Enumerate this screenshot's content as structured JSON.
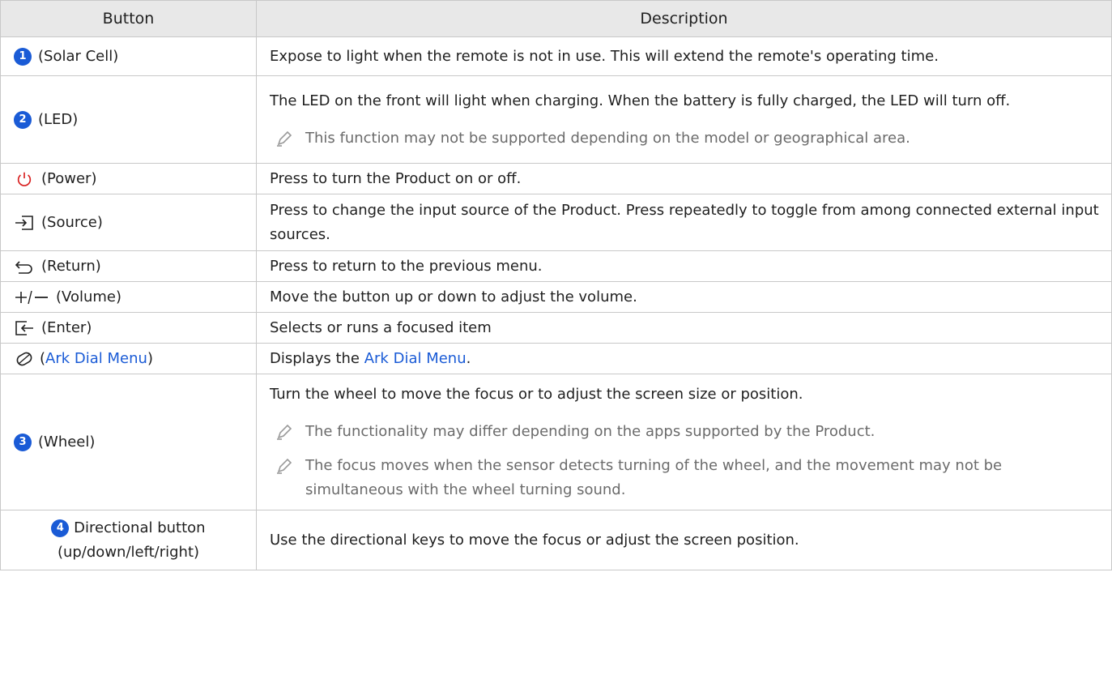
{
  "header": {
    "col1": "Button",
    "col2": "Description"
  },
  "rows": [
    {
      "badge": "1",
      "label": "(Solar Cell)",
      "desc": "Expose to light when the remote is not in use. This will extend the remote's operating time."
    },
    {
      "badge": "2",
      "label": "(LED)",
      "desc": "The LED on the front will light when charging. When the battery is fully charged, the LED will turn off.",
      "note": "This function may not be supported depending on the model or geographical area."
    },
    {
      "icon": "power-icon",
      "label": "(Power)",
      "desc": "Press to turn the Product on or off."
    },
    {
      "icon": "source-icon",
      "label": "(Source)",
      "desc": "Press to change the input source of the Product. Press repeatedly to toggle from among connected external input sources."
    },
    {
      "icon": "return-icon",
      "label": "(Return)",
      "desc": "Press to return to the previous menu."
    },
    {
      "icon": "volume-icon",
      "label": "(Volume)",
      "desc": "Move the button up or down to adjust the volume."
    },
    {
      "icon": "enter-icon",
      "label": "(Enter)",
      "desc": "Selects or runs a focused item"
    },
    {
      "icon": "ark-dial-icon",
      "label_open": "(",
      "link": "Ark Dial Menu",
      "label_close": ")",
      "desc_pre": "Displays the ",
      "desc_link": "Ark Dial Menu",
      "desc_post": "."
    },
    {
      "badge": "3",
      "label": "(Wheel)",
      "desc": "Turn the wheel to move the focus or to adjust the screen size or position.",
      "notes": [
        "The functionality may differ depending on the apps supported by the Product.",
        "The focus moves when the sensor detects turning of the wheel, and the movement may not be simultaneous with the wheel turning sound."
      ]
    },
    {
      "badge": "4",
      "label": "Directional button (up/down/left/right)",
      "desc": "Use the directional keys to move the focus or adjust the screen position."
    }
  ],
  "colors": {
    "badge": "#1a5bd6",
    "power": "#d81e1e",
    "link": "#1a5bd6",
    "header_bg": "#e8e8e8"
  }
}
